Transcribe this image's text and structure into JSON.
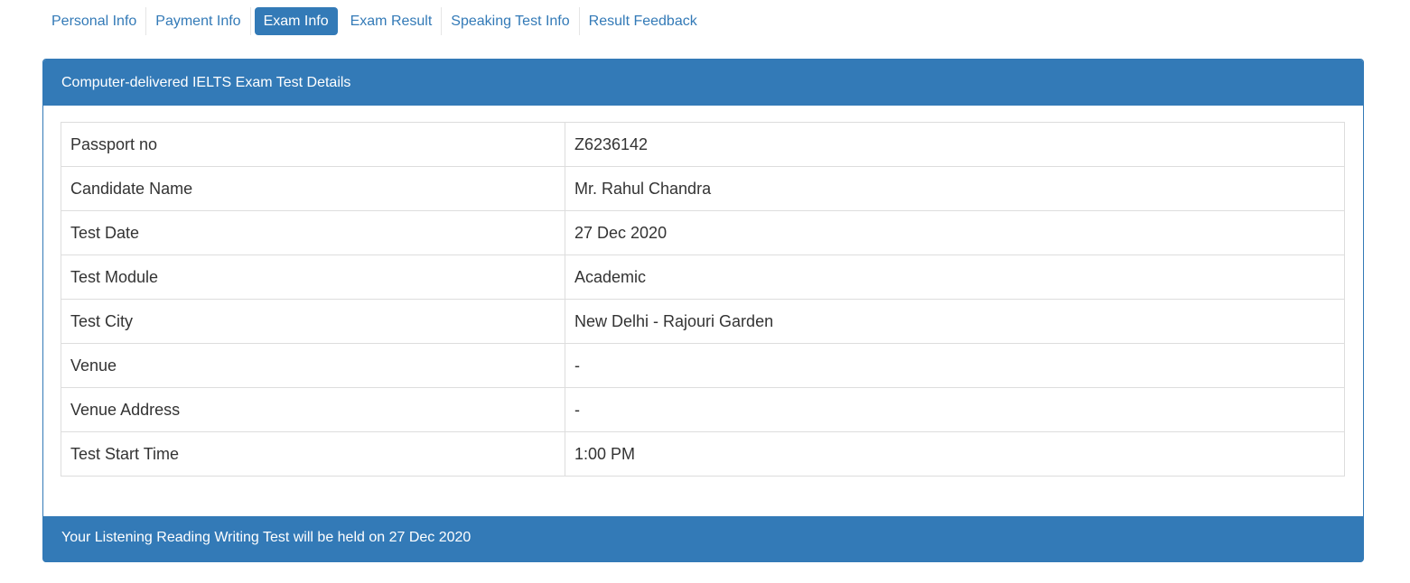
{
  "tabs": [
    {
      "label": "Personal Info",
      "active": false
    },
    {
      "label": "Payment Info",
      "active": false
    },
    {
      "label": "Exam Info",
      "active": true
    },
    {
      "label": "Exam Result",
      "active": false
    },
    {
      "label": "Speaking Test Info",
      "active": false
    },
    {
      "label": "Result Feedback",
      "active": false
    }
  ],
  "panel": {
    "title": "Computer-delivered IELTS Exam Test Details",
    "rows": [
      {
        "label": "Passport no",
        "value": "Z6236142"
      },
      {
        "label": "Candidate Name",
        "value": "Mr. Rahul Chandra"
      },
      {
        "label": "Test Date",
        "value": "27 Dec 2020"
      },
      {
        "label": "Test Module",
        "value": "Academic"
      },
      {
        "label": "Test City",
        "value": "New Delhi - Rajouri Garden"
      },
      {
        "label": "Venue",
        "value": "-"
      },
      {
        "label": "Venue Address",
        "value": "-"
      },
      {
        "label": "Test Start Time",
        "value": "1:00 PM"
      }
    ],
    "footer": "Your Listening Reading Writing Test will be held on 27 Dec 2020"
  },
  "colors": {
    "primary": "#337ab7"
  }
}
